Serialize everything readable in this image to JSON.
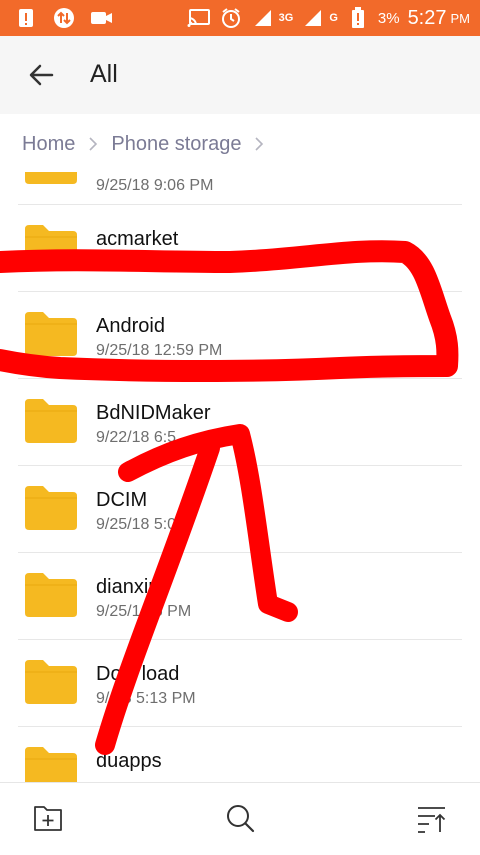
{
  "status_bar": {
    "network_3g": "3G",
    "network_g": "G",
    "battery": "3%",
    "time": "5:27",
    "ampm": "PM"
  },
  "header": {
    "title": "All"
  },
  "breadcrumb": {
    "items": [
      "Home",
      "Phone storage"
    ]
  },
  "files": [
    {
      "name": "",
      "date": "9/25/18 9:06 PM"
    },
    {
      "name": "acmarket",
      "date": ""
    },
    {
      "name": "Android",
      "date": "9/25/18 12:59 PM"
    },
    {
      "name": "BdNIDMaker",
      "date": "9/22/18 6:5"
    },
    {
      "name": "DCIM",
      "date": "9/25/18 5:0"
    },
    {
      "name": "dianxin",
      "date": "9/25/1  06 PM"
    },
    {
      "name": "Dow  load",
      "date": "9/  18 5:13 PM"
    },
    {
      "name": "duapps",
      "date": ""
    }
  ],
  "colors": {
    "status_bar": "#f26a2a",
    "folder": "#f5b921",
    "annotation": "#ff0000"
  },
  "icons": {
    "back": "arrow-left-icon",
    "new_folder": "add-folder-icon",
    "search": "search-icon",
    "sort": "sort-icon"
  }
}
